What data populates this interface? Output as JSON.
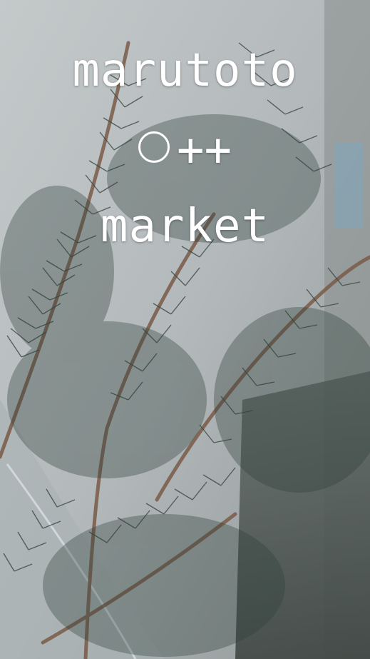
{
  "overlay": {
    "line1": "marutoto",
    "line2_symbols": "++",
    "line3": "market"
  },
  "colors": {
    "text": "#ffffff",
    "background": "#b9bec0",
    "foliage": "#2f3f38"
  },
  "icons": [
    "circle-icon"
  ]
}
